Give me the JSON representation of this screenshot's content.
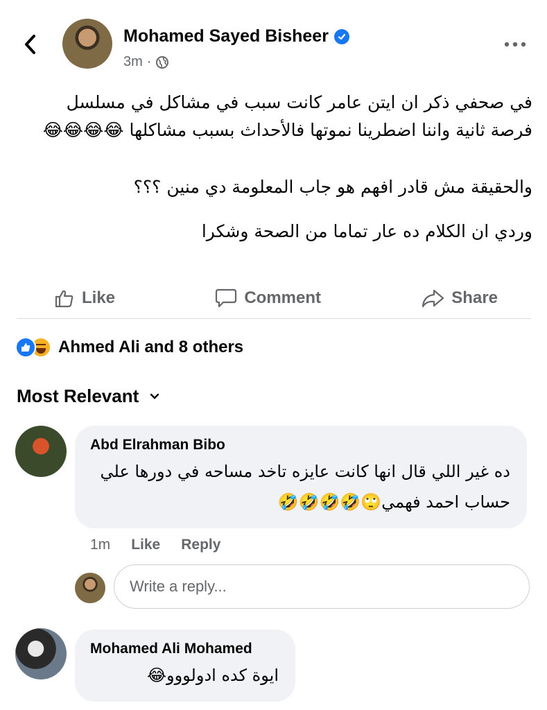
{
  "post": {
    "author": "Mohamed Sayed Bisheer",
    "time": "3m",
    "separator": "·",
    "paragraphs": [
      "في صحفي ذكر ان ايتن عامر كانت سبب في مشاكل في مسلسل فرصة ثانية واننا اضطرينا نموتها فالأحداث بسبب مشاكلها 😂😂😂😂",
      "والحقيقة مش قادر افهم هو جاب المعلومة دي منين ؟؟؟",
      "وردي ان الكلام ده عار تماما من الصحة وشكرا"
    ]
  },
  "actions": {
    "like": "Like",
    "comment": "Comment",
    "share": "Share"
  },
  "reactions": {
    "summary": "Ahmed Ali and 8 others"
  },
  "sort": {
    "label": "Most Relevant"
  },
  "comments": [
    {
      "name": "Abd Elrahman Bibo",
      "text": "ده غير اللي قال انها كانت عايزه تاخد مساحه في دورها علي حساب احمد فهمي🙄🤣🤣🤣🤣",
      "time": "1m",
      "like": "Like",
      "reply": "Reply"
    },
    {
      "name": "Mohamed Ali Mohamed",
      "text": "ايوة كده ادولووو😂"
    }
  ],
  "reply_box": {
    "placeholder": "Write a reply..."
  },
  "colors": {
    "verified": "#1877f2",
    "muted": "#65676b",
    "bubble": "#f0f2f5"
  }
}
